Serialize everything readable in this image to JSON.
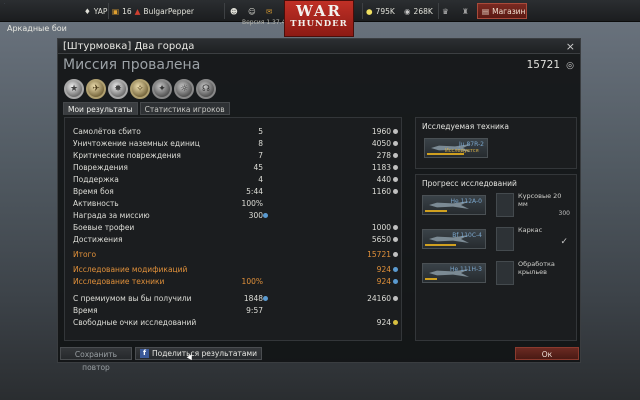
{
  "topbar": {
    "rank": "YAP",
    "level": "16",
    "nickname": "BulgarPepper",
    "version": "Версия 1.37.45.29",
    "logo_line1": "WAR",
    "logo_line2": "THUNDER",
    "silver_lions": "795K",
    "research_points": "268K",
    "shop_label": "Магазин",
    "colors": {
      "accent_red": "#b8281e"
    }
  },
  "mode_label": "Аркадные бои",
  "window": {
    "title": "[Штурмовка] Два города",
    "close_glyph": "×",
    "result": "Миссия провалена",
    "total_score": "15721",
    "medals": [
      "★",
      "✈",
      "✸",
      "✧",
      "✦",
      "☼",
      "☊"
    ],
    "tabs": [
      "Мои результаты",
      "Статистика игроков"
    ],
    "stats": [
      {
        "label": "Самолётов сбито",
        "count": "5",
        "value": "1960",
        "cur": "s",
        "style": ""
      },
      {
        "label": "Уничтожение наземных единиц",
        "count": "8",
        "value": "4050",
        "cur": "s",
        "style": ""
      },
      {
        "label": "Критические повреждения",
        "count": "7",
        "value": "278",
        "cur": "s",
        "style": ""
      },
      {
        "label": "Повреждения",
        "count": "45",
        "value": "1183",
        "cur": "s",
        "style": ""
      },
      {
        "label": "Поддержка",
        "count": "4",
        "value": "440",
        "cur": "s",
        "style": ""
      },
      {
        "label": "Время боя",
        "count": "5:44",
        "value": "1160",
        "cur": "s",
        "style": ""
      },
      {
        "label": "Активность",
        "count": "100%",
        "value": "",
        "cur": "",
        "style": ""
      },
      {
        "label": "Награда за миссию",
        "count": "300",
        "value": "",
        "cur": "rp",
        "style": ""
      },
      {
        "label": "Боевые трофеи",
        "count": "",
        "value": "1000",
        "cur": "s",
        "style": ""
      },
      {
        "label": "Достижения",
        "count": "",
        "value": "5650",
        "cur": "s",
        "style": ""
      },
      {
        "label": "Итого",
        "count": "",
        "value": "15721",
        "cur": "s",
        "style": "orange"
      },
      {
        "label": "Исследование модификаций",
        "count": "",
        "value": "924",
        "cur": "rp",
        "style": "orange"
      },
      {
        "label": "Исследование техники",
        "count": "100%",
        "value": "924",
        "cur": "rp",
        "style": "orange"
      },
      {
        "label": "С премиумом вы бы получили",
        "count": "1848",
        "value": "24160",
        "cur": "s",
        "style": ""
      },
      {
        "label": "Время",
        "count": "9:57",
        "value": "",
        "cur": "",
        "style": ""
      },
      {
        "label": "Свободные очки исследований",
        "count": "",
        "value": "924",
        "cur": "y",
        "style": ""
      }
    ],
    "research": {
      "title": "Исследуемая техника",
      "vehicle": "Ju 87R-2",
      "vehicle_tag": "Исследуется",
      "progress_title": "Прогресс исследований",
      "rows": [
        {
          "plane": "He 112A-0",
          "mod": "Курсовые 20 мм",
          "mod_value": "300",
          "plane_progress": 0.35
        },
        {
          "plane": "Bf 110C-4",
          "mod": "Каркас",
          "mod_value": "",
          "plane_progress": 0.5
        },
        {
          "plane": "He 111H-3",
          "mod": "Обработка крыльев",
          "mod_value": "",
          "plane_progress": 0.2
        }
      ]
    }
  },
  "footer": {
    "save_replay": "Сохранить повтор",
    "share": "Поделиться результатами",
    "ok": "Ок"
  }
}
